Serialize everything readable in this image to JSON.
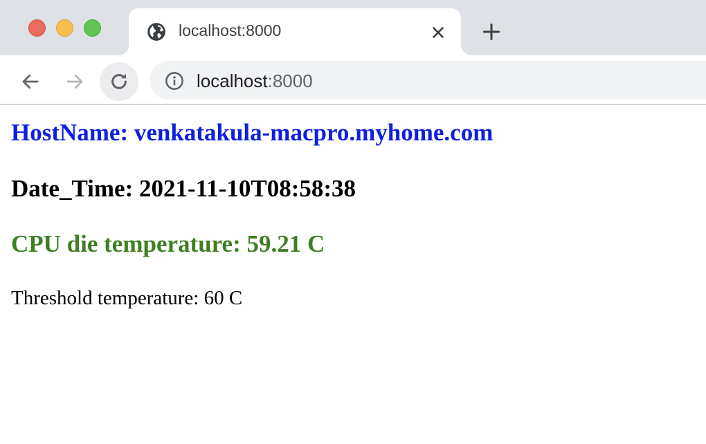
{
  "browser": {
    "tab": {
      "title": "localhost:8000",
      "favicon": "globe-icon"
    },
    "address_bar": {
      "host": "localhost",
      "port": ":8000",
      "security_icon": "info-icon"
    },
    "controls": {
      "back": "arrow-left-icon",
      "forward": "arrow-right-icon",
      "reload": "reload-icon",
      "close_tab": "close-icon",
      "new_tab": "plus-icon"
    },
    "window_buttons": [
      "close",
      "minimize",
      "zoom"
    ]
  },
  "page": {
    "hostname": "HostName: venkatakula-macpro.myhome.com",
    "datetime": "Date_Time: 2021-11-10T08:58:38",
    "cpu_temperature": "CPU die temperature: 59.21 C",
    "threshold": "Threshold temperature: 60 C"
  },
  "colors": {
    "hostname": "#0d1fe0",
    "datetime": "#000000",
    "cpu_temperature": "#3f7f22",
    "threshold": "#000000",
    "tabstrip_bg": "#dee1e6",
    "omnibox_bg": "#f1f3f4"
  }
}
